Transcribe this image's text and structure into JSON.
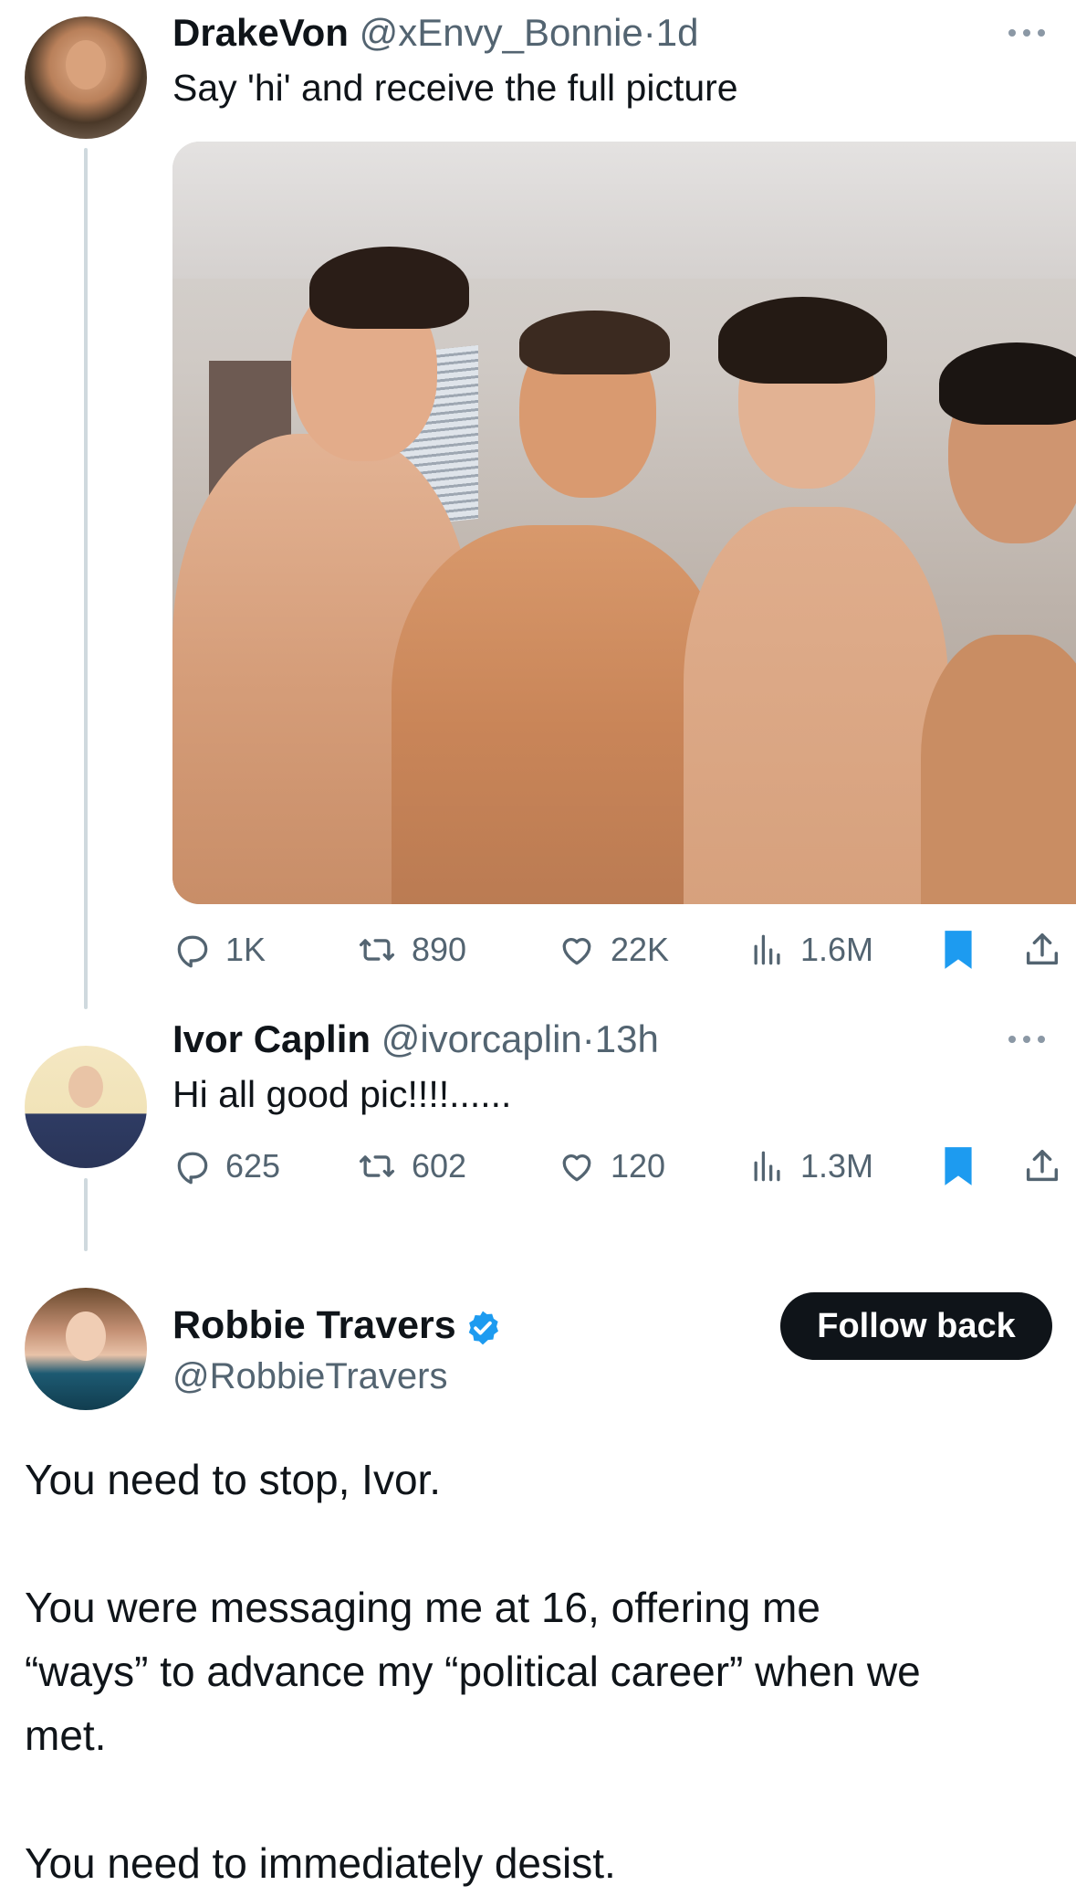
{
  "tweets": [
    {
      "name": "DrakeVon",
      "handle": "@xEnvy_Bonnie",
      "time": "1d",
      "text": "Say 'hi' and receive the full picture",
      "stats": {
        "replies": "1K",
        "reposts": "890",
        "likes": "22K",
        "views": "1.6M"
      }
    },
    {
      "name": "Ivor Caplin",
      "handle": "@ivorcaplin",
      "time": "13h",
      "text": "Hi all good pic!!!!......",
      "stats": {
        "replies": "625",
        "reposts": "602",
        "likes": "120",
        "views": "1.3M"
      }
    }
  ],
  "separator": "·",
  "main_post": {
    "name": "Robbie Travers",
    "handle": "@RobbieTravers",
    "follow_label": "Follow back",
    "paragraphs": [
      "You need to stop, Ivor.",
      "You were messaging me at 16, offering me",
      "“ways” to advance my “political career” when we",
      "met.",
      "You need to immediately desist."
    ]
  },
  "colors": {
    "accent": "#1d9bf0",
    "text": "#0f1419",
    "muted": "#536471",
    "button_bg": "#0f1419",
    "thread_line": "#cfd9de"
  },
  "icons": [
    "reply-icon",
    "repost-icon",
    "like-icon",
    "views-icon",
    "bookmark-icon",
    "share-icon",
    "more-icon",
    "verified-badge-icon"
  ]
}
